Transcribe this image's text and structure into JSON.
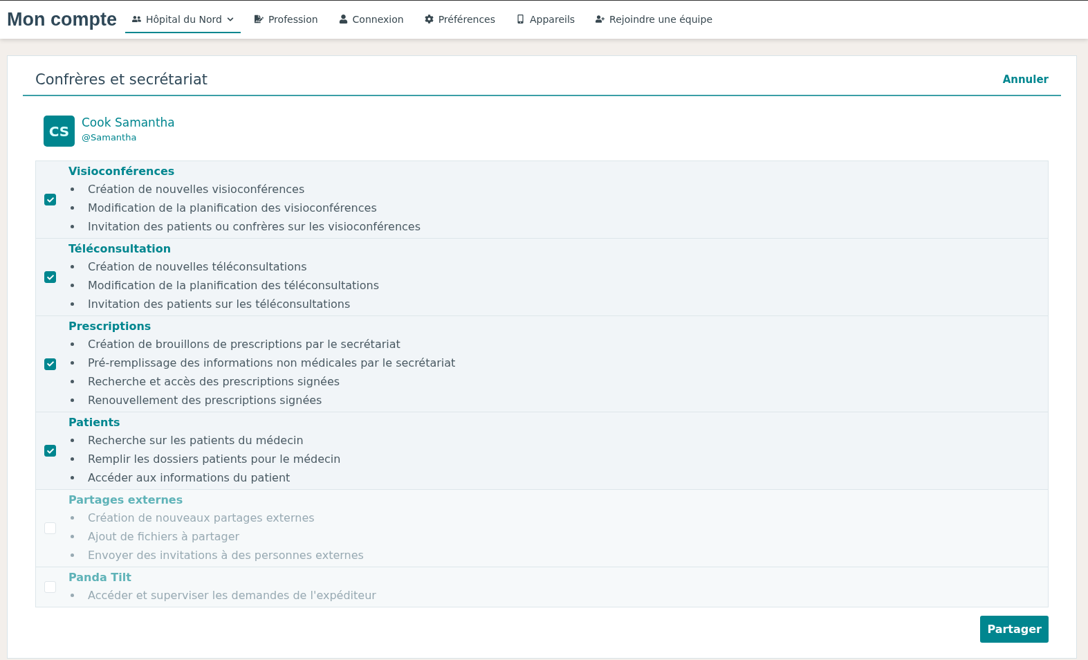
{
  "header": {
    "title": "Mon compte",
    "tabs": [
      {
        "label": "Hôpital du Nord",
        "dropdown": true,
        "selected": true
      },
      {
        "label": "Profession",
        "dropdown": false,
        "selected": false
      },
      {
        "label": "Connexion",
        "dropdown": false,
        "selected": false
      },
      {
        "label": "Préférences",
        "dropdown": false,
        "selected": false
      },
      {
        "label": "Appareils",
        "dropdown": false,
        "selected": false
      },
      {
        "label": "Rejoindre une équipe",
        "dropdown": false,
        "selected": false
      }
    ]
  },
  "card": {
    "title": "Confrères et secrétariat",
    "cancel": "Annuler",
    "user": {
      "initials": "CS",
      "name": "Cook Samantha",
      "handle": "@Samantha"
    },
    "sections": [
      {
        "title": "Visioconférences",
        "checked": true,
        "disabled": false,
        "items": [
          "Création de nouvelles visioconférences",
          "Modification de la planification des visioconférences",
          "Invitation des patients ou confrères sur les visioconférences"
        ]
      },
      {
        "title": "Téléconsultation",
        "checked": true,
        "disabled": false,
        "items": [
          "Création de nouvelles téléconsultations",
          "Modification de la planification des téléconsultations",
          "Invitation des patients sur les téléconsultations"
        ]
      },
      {
        "title": "Prescriptions",
        "checked": true,
        "disabled": false,
        "items": [
          "Création de brouillons de prescriptions par le secrétariat",
          "Pré-remplissage des informations non médicales par le secrétariat",
          "Recherche et accès des prescriptions signées",
          "Renouvellement des prescriptions signées"
        ]
      },
      {
        "title": "Patients",
        "checked": true,
        "disabled": false,
        "items": [
          "Recherche sur les patients du médecin",
          "Remplir les dossiers patients pour le médecin",
          "Accéder aux informations du patient"
        ]
      },
      {
        "title": "Partages externes",
        "checked": false,
        "disabled": true,
        "items": [
          "Création de nouveaux partages externes",
          "Ajout de fichiers à partager",
          "Envoyer des invitations à des personnes externes"
        ]
      },
      {
        "title": "Panda Tilt",
        "checked": false,
        "disabled": true,
        "items": [
          "Accéder et superviser les demandes de l'expéditeur"
        ]
      }
    ],
    "submit": "Partager"
  }
}
